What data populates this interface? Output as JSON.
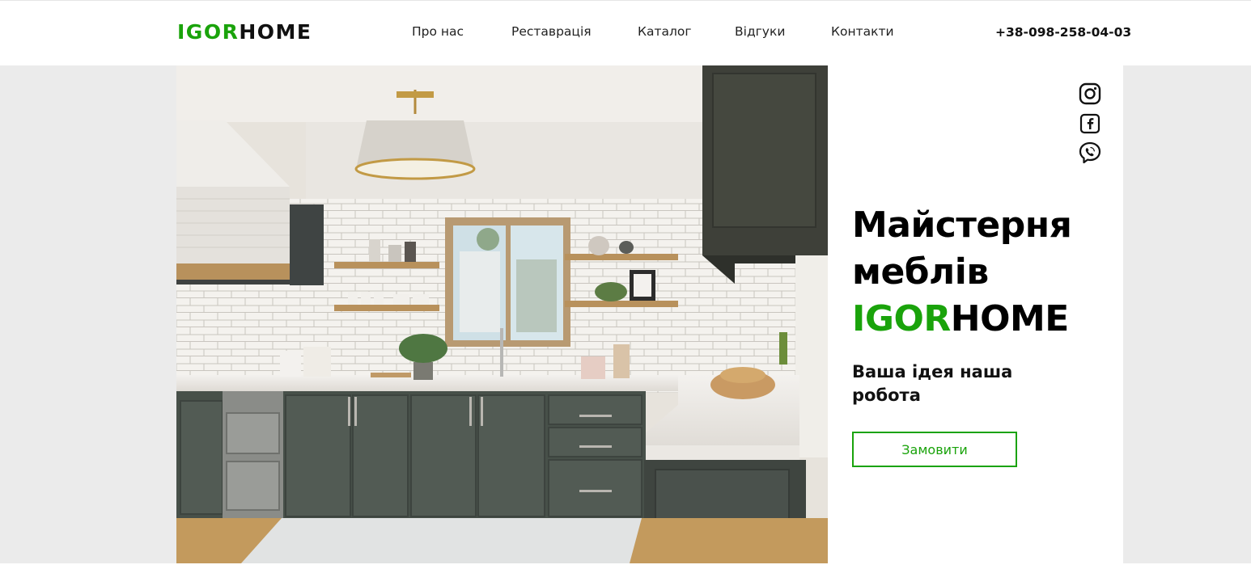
{
  "header": {
    "logo": {
      "part1": "IGOR",
      "part2": "HOME"
    },
    "nav": [
      {
        "label": "Про нас"
      },
      {
        "label": "Реставрація"
      },
      {
        "label": "Каталог"
      },
      {
        "label": "Відгуки"
      },
      {
        "label": "Контакти"
      }
    ],
    "phone": "+38-098-258-04-03"
  },
  "hero": {
    "title_line1": "Майстерня",
    "title_line2": "меблів",
    "title_brand1": "IGOR",
    "title_brand2": "HOME",
    "tagline": "Ваша ідея наша робота",
    "order_button": "Замовити",
    "image_icon": "kitchen-photo",
    "social": [
      {
        "icon": "instagram-icon"
      },
      {
        "icon": "facebook-icon"
      },
      {
        "icon": "viber-icon"
      }
    ]
  },
  "colors": {
    "accent": "#1aa30b",
    "text": "#111111",
    "hero_background": "#ebebeb"
  }
}
